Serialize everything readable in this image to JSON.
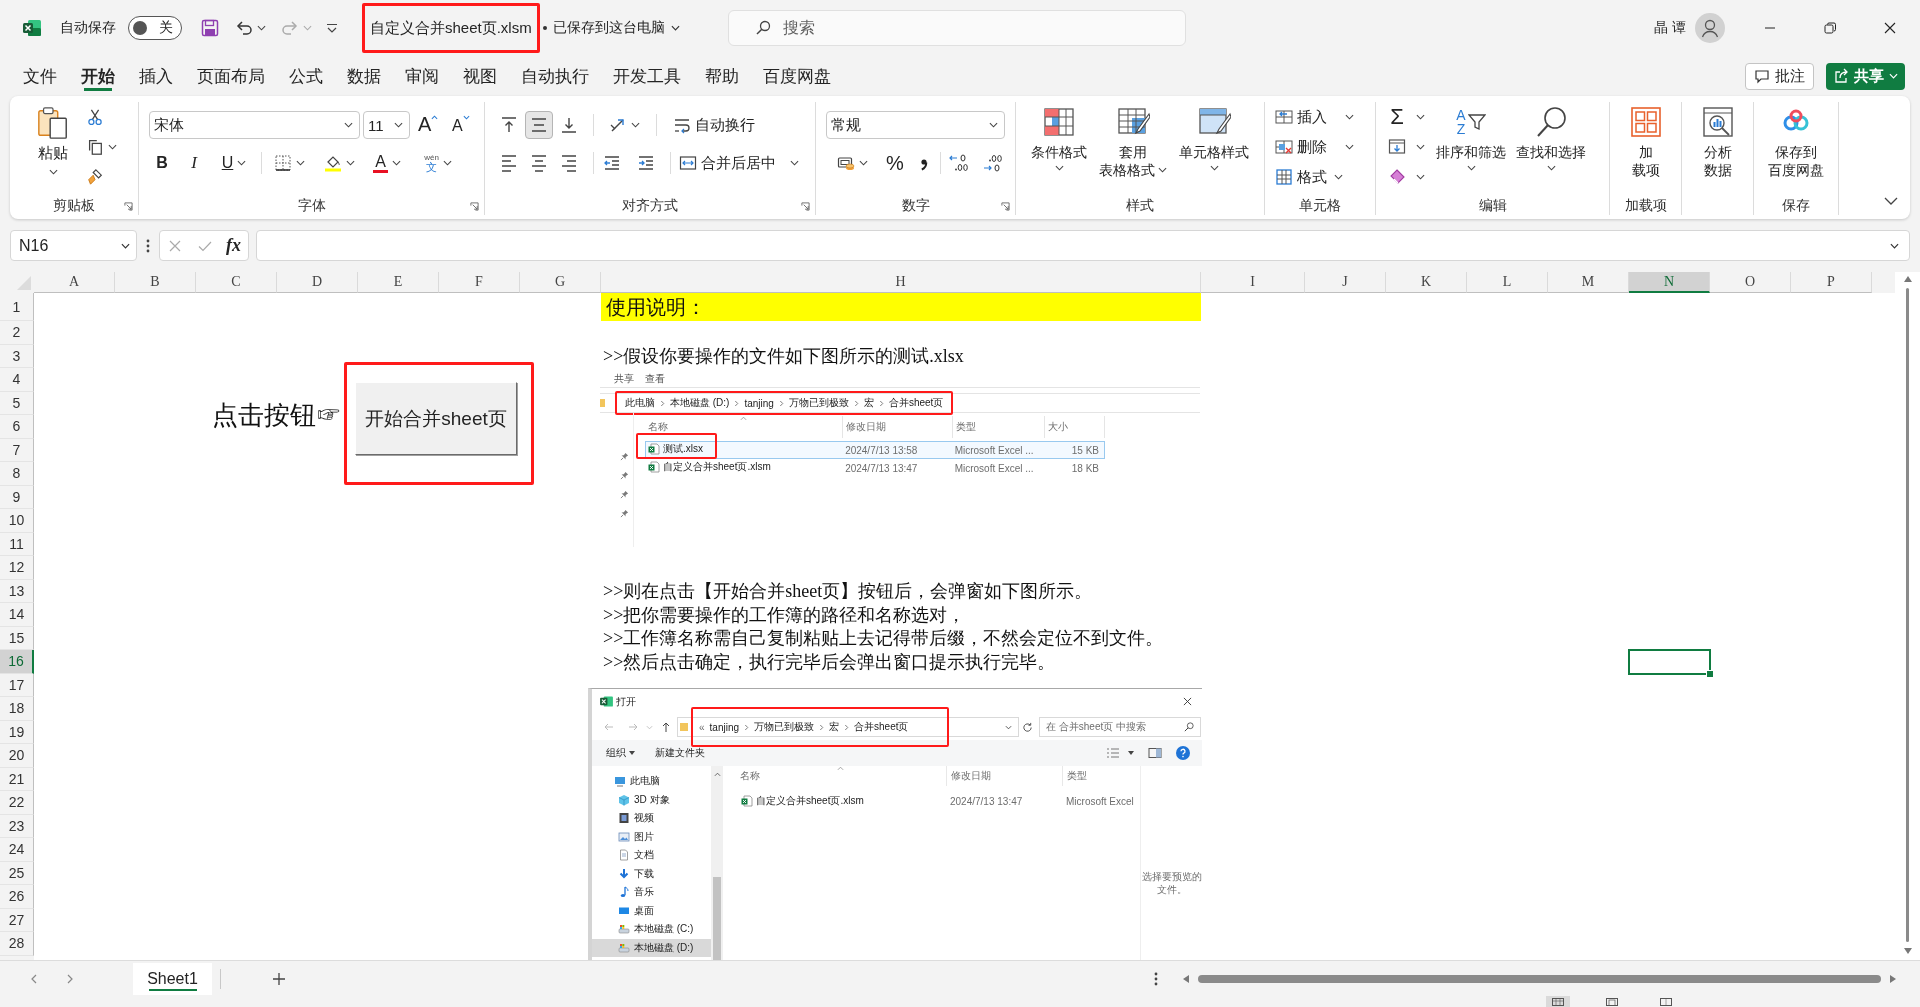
{
  "title_bar": {
    "autosave_label": "自动保存",
    "autosave": {
      "on": false,
      "label": "关"
    },
    "file_name": {
      "text": "自定义合并sheet页.xlsm",
      "highlighted": true
    },
    "save_status": "已保存到这台电脑",
    "search": {
      "placeholder": "搜索"
    },
    "user_name": "晶 谭"
  },
  "menu": {
    "tabs": [
      {
        "label": "文件",
        "selected": false
      },
      {
        "label": "开始",
        "selected": true
      },
      {
        "label": "插入",
        "selected": false
      },
      {
        "label": "页面布局",
        "selected": false
      },
      {
        "label": "公式",
        "selected": false
      },
      {
        "label": "数据",
        "selected": false
      },
      {
        "label": "审阅",
        "selected": false
      },
      {
        "label": "视图",
        "selected": false
      },
      {
        "label": "自动执行",
        "selected": false
      },
      {
        "label": "开发工具",
        "selected": false
      },
      {
        "label": "帮助",
        "selected": false
      },
      {
        "label": "百度网盘",
        "selected": false
      }
    ],
    "comment_button": "批注",
    "share_button": "共享"
  },
  "ribbon": {
    "clipboard": {
      "label": "剪贴板",
      "paste": "粘贴"
    },
    "font": {
      "label": "字体",
      "font_name": "宋体",
      "font_size": "11",
      "grow": "A",
      "shrink": "A",
      "bold": "B",
      "italic": "I",
      "underline": "U",
      "font_color": "A",
      "phonetic": {
        "ruby": "wén",
        "base": "文"
      }
    },
    "alignment": {
      "label": "对齐方式",
      "vertical": [
        {
          "kind": "top",
          "selected": false
        },
        {
          "kind": "middle",
          "selected": true
        },
        {
          "kind": "bottom",
          "selected": false
        }
      ],
      "horizontal": [
        {
          "kind": "left",
          "selected": false
        },
        {
          "kind": "center",
          "selected": false
        },
        {
          "kind": "right",
          "selected": false
        }
      ],
      "wrap_text": "自动换行",
      "merge_center": "合并后居中"
    },
    "number": {
      "label": "数字",
      "format": "常规",
      "percent": "%"
    },
    "styles": {
      "label": "样式",
      "conditional": "条件格式",
      "table": [
        "套用",
        "表格格式"
      ],
      "cell_styles": "单元格样式"
    },
    "cells": {
      "label": "单元格",
      "insert": "插入",
      "delete": "删除",
      "format": "格式"
    },
    "editing": {
      "label": "编辑",
      "sum": "Σ",
      "sort_glyphs": [
        "A",
        "Z"
      ],
      "sort_filter": "排序和筛选",
      "find_select": "查找和选择"
    },
    "addins": {
      "label": "加载项",
      "button": [
        "加",
        "载项"
      ]
    },
    "analysis": {
      "button": [
        "分析",
        "数据"
      ]
    },
    "save": {
      "label": "保存",
      "button": [
        "保存到",
        "百度网盘"
      ]
    }
  },
  "formula_bar": {
    "name_box": "N16",
    "fx": "fx"
  },
  "sheet": {
    "columns": [
      {
        "label": "A",
        "selected": false
      },
      {
        "label": "B",
        "selected": false
      },
      {
        "label": "C",
        "selected": false
      },
      {
        "label": "D",
        "selected": false
      },
      {
        "label": "E",
        "selected": false
      },
      {
        "label": "F",
        "selected": false
      },
      {
        "label": "G",
        "selected": false
      },
      {
        "label": "H",
        "selected": false
      },
      {
        "label": "I",
        "selected": false
      },
      {
        "label": "J",
        "selected": false
      },
      {
        "label": "K",
        "selected": false
      },
      {
        "label": "L",
        "selected": false
      },
      {
        "label": "M",
        "selected": false
      },
      {
        "label": "N",
        "selected": true
      },
      {
        "label": "O",
        "selected": false
      },
      {
        "label": "P",
        "selected": false
      }
    ],
    "rows": [
      {
        "label": "1",
        "selected": false
      },
      {
        "label": "2",
        "selected": false
      },
      {
        "label": "3",
        "selected": false
      },
      {
        "label": "4",
        "selected": false
      },
      {
        "label": "5",
        "selected": false
      },
      {
        "label": "6",
        "selected": false
      },
      {
        "label": "7",
        "selected": false
      },
      {
        "label": "8",
        "selected": false
      },
      {
        "label": "9",
        "selected": false
      },
      {
        "label": "10",
        "selected": false
      },
      {
        "label": "11",
        "selected": false
      },
      {
        "label": "12",
        "selected": false
      },
      {
        "label": "13",
        "selected": false
      },
      {
        "label": "14",
        "selected": false
      },
      {
        "label": "15",
        "selected": false
      },
      {
        "label": "16",
        "selected": true
      },
      {
        "label": "17",
        "selected": false
      },
      {
        "label": "18",
        "selected": false
      },
      {
        "label": "19",
        "selected": false
      },
      {
        "label": "20",
        "selected": false
      },
      {
        "label": "21",
        "selected": false
      },
      {
        "label": "22",
        "selected": false
      },
      {
        "label": "23",
        "selected": false
      },
      {
        "label": "24",
        "selected": false
      },
      {
        "label": "25",
        "selected": false
      },
      {
        "label": "26",
        "selected": false
      },
      {
        "label": "27",
        "selected": false
      },
      {
        "label": "28",
        "selected": false
      }
    ],
    "cells": [
      {
        "kind": "heading",
        "text": "使用说明："
      },
      {
        "kind": "body",
        "text": ">>假设你要操作的文件如下图所示的测试.xlsx"
      },
      {
        "kind": "callout",
        "text": "点击按钮☞"
      },
      {
        "kind": "body",
        "text": ">>则在点击【开始合并sheet页】按钮后，会弹窗如下图所示。"
      },
      {
        "kind": "body",
        "text": ">>把你需要操作的工作簿的路径和名称选对，"
      },
      {
        "kind": "body",
        "text": ">>工作簿名称需自己复制粘贴上去记得带后缀，不然会定位不到文件。"
      },
      {
        "kind": "body",
        "text": ">>然后点击确定，执行完毕后会弹出窗口提示执行完毕。"
      }
    ],
    "buttons": [
      {
        "label": "开始合并sheet页",
        "highlighted": true
      }
    ],
    "pictures": [
      {
        "kind": "explorer",
        "tabs": [
          "共享",
          "查看"
        ],
        "breadcrumb": {
          "items": [
            "此电脑",
            "本地磁盘 (D:)",
            "tanjing",
            "万物已到极致",
            "宏",
            "合并sheet页"
          ],
          "highlighted": true
        },
        "columns": [
          "名称",
          "修改日期",
          "类型",
          "大小"
        ],
        "files": [
          {
            "name": "测试.xlsx",
            "date": "2024/7/13 13:58",
            "type": "Microsoft Excel ...",
            "size": "15 KB",
            "selected": true,
            "highlighted": true
          },
          {
            "name": "自定义合并sheet页.xlsm",
            "date": "2024/7/13 13:47",
            "type": "Microsoft Excel ...",
            "size": "18 KB",
            "selected": false,
            "highlighted": false
          }
        ]
      },
      {
        "kind": "open_dialog",
        "title": "打开",
        "breadcrumb": {
          "overflow": "«",
          "items": [
            "tanjing",
            "万物已到极致",
            "宏",
            "合并sheet页"
          ],
          "highlighted": true
        },
        "search_placeholder": "在 合并sheet页 中搜索",
        "organize": "组织",
        "new_folder": "新建文件夹",
        "nav": [
          {
            "label": "此电脑",
            "kind": "pc",
            "selected": false,
            "children": [
              {
                "label": "3D 对象",
                "kind": "objects3d",
                "selected": false
              },
              {
                "label": "视频",
                "kind": "video",
                "selected": false
              },
              {
                "label": "图片",
                "kind": "pictures",
                "selected": false
              },
              {
                "label": "文档",
                "kind": "documents",
                "selected": false
              },
              {
                "label": "下载",
                "kind": "downloads",
                "selected": false
              },
              {
                "label": "音乐",
                "kind": "music",
                "selected": false
              },
              {
                "label": "桌面",
                "kind": "desktop",
                "selected": false
              },
              {
                "label": "本地磁盘 (C:)",
                "kind": "drive",
                "selected": false
              },
              {
                "label": "本地磁盘 (D:)",
                "kind": "drive",
                "selected": true
              }
            ]
          }
        ],
        "columns": [
          "名称",
          "修改日期",
          "类型"
        ],
        "files": [
          {
            "name": "自定义合并sheet页.xlsm",
            "date": "2024/7/13 13:47",
            "type": "Microsoft Excel"
          }
        ],
        "preview_hint": "选择要预览的文件。"
      }
    ]
  },
  "sheet_tabs": [
    {
      "label": "Sheet1",
      "selected": true
    }
  ],
  "status_bar": {
    "views": [
      {
        "kind": "normal",
        "selected": true
      },
      {
        "kind": "page_layout",
        "selected": false
      },
      {
        "kind": "page_break",
        "selected": false
      }
    ]
  }
}
